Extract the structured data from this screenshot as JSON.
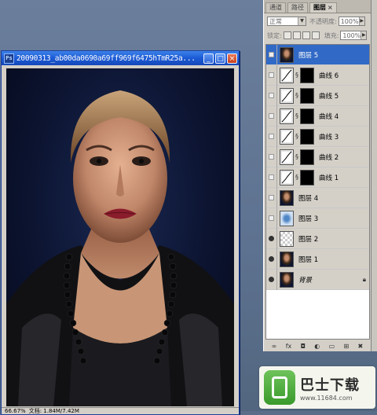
{
  "document": {
    "title": "20090313_ab00da0690a69ff969f6475hTmR25a...",
    "app_icon": "Ps",
    "zoom": "66.67%",
    "info": "文档: 1.84M/7.42M"
  },
  "window_buttons": {
    "minimize": "_",
    "maximize": "□",
    "close": "×"
  },
  "layers_panel": {
    "tabs": [
      "通道",
      "路径",
      "图层"
    ],
    "active_tab": "图层",
    "tab_close": "×",
    "blend_mode": "正常",
    "opacity_label": "不透明度:",
    "opacity_value": "100%",
    "lock_label": "锁定:",
    "fill_label": "填充:",
    "fill_value": "100%",
    "layers": [
      {
        "name": "图层 5",
        "visible": false,
        "selected": true,
        "thumb": "portrait"
      },
      {
        "name": "曲线 6",
        "visible": false,
        "type": "adjustment"
      },
      {
        "name": "曲线 5",
        "visible": false,
        "type": "adjustment"
      },
      {
        "name": "曲线 4",
        "visible": false,
        "type": "adjustment"
      },
      {
        "name": "曲线 3",
        "visible": false,
        "type": "adjustment"
      },
      {
        "name": "曲线 2",
        "visible": false,
        "type": "adjustment"
      },
      {
        "name": "曲线 1",
        "visible": false,
        "type": "adjustment"
      },
      {
        "name": "图层 4",
        "visible": false,
        "thumb": "portrait"
      },
      {
        "name": "图层 3",
        "visible": false,
        "thumb": "bluefig"
      },
      {
        "name": "图层 2",
        "visible": true,
        "thumb": "checker"
      },
      {
        "name": "图层 1",
        "visible": true,
        "thumb": "portrait"
      },
      {
        "name": "背景",
        "visible": true,
        "thumb": "portrait",
        "locked": true
      }
    ],
    "footer_icons": [
      "link-icon",
      "fx-icon",
      "mask-icon",
      "adjustment-icon",
      "folder-icon",
      "new-layer-icon",
      "trash-icon"
    ],
    "footer_glyphs": [
      "∞",
      "fx",
      "◘",
      "◐",
      "▭",
      "⊞",
      "✖"
    ]
  },
  "watermark": {
    "main": "巴士下载",
    "url": "www.11684.com"
  }
}
